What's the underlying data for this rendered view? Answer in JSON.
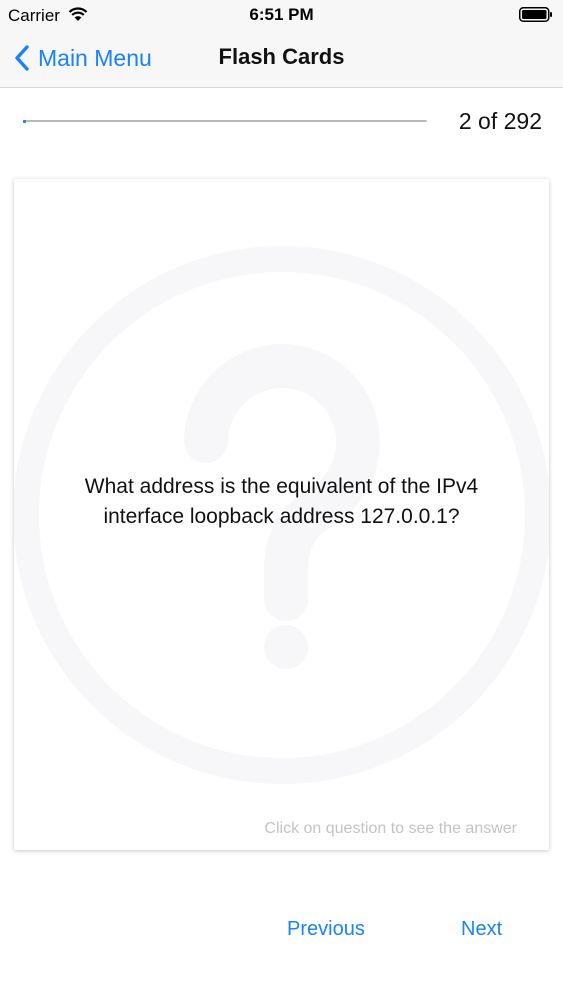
{
  "status_bar": {
    "carrier": "Carrier",
    "time": "6:51 PM",
    "icons": [
      "wifi-icon",
      "battery-icon"
    ]
  },
  "nav_bar": {
    "back_label": "Main Menu",
    "title": "Flash Cards"
  },
  "progress": {
    "current": 2,
    "total": 292,
    "label": "2 of 292"
  },
  "card": {
    "question": "What address is the equivalent of the IPv4 interface loopback address 127.0.0.1?",
    "hint": "Click on question to see the answer",
    "watermark_icon": "question-mark-icon"
  },
  "footer": {
    "previous_label": "Previous",
    "next_label": "Next"
  },
  "colors": {
    "accent": "#1a82fb",
    "bar_background": "#f7f7f7",
    "hint_text": "#c4c4c8"
  }
}
